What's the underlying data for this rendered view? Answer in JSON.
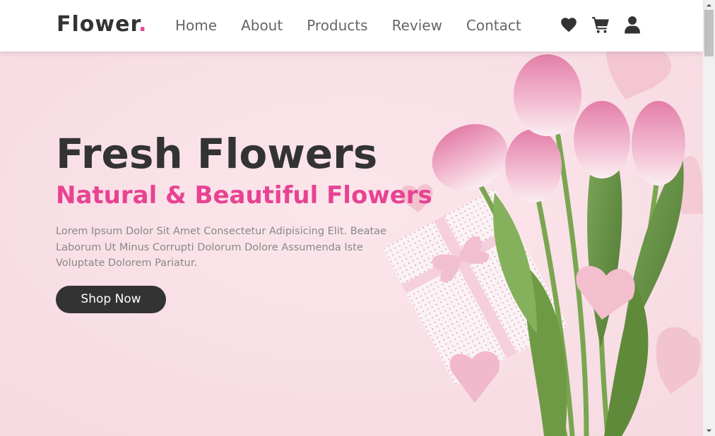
{
  "header": {
    "logo_text": "Flower",
    "logo_dot": ".",
    "nav": [
      "Home",
      "About",
      "Products",
      "Review",
      "Contact"
    ],
    "icons": [
      "heart-icon",
      "cart-icon",
      "user-icon"
    ]
  },
  "hero": {
    "title": "Fresh Flowers",
    "subtitle": "Natural & Beautiful Flowers",
    "description": "Lorem Ipsum Dolor Sit Amet Consectetur Adipisicing Elit. Beatae Laborum Ut Minus Corrupti Dolorum Dolore Assumenda Iste Voluptate Dolorem Pariatur.",
    "button_label": "Shop Now"
  },
  "colors": {
    "accent": "#e84393",
    "dark": "#333333",
    "hero_background": "#f8dfe5"
  }
}
